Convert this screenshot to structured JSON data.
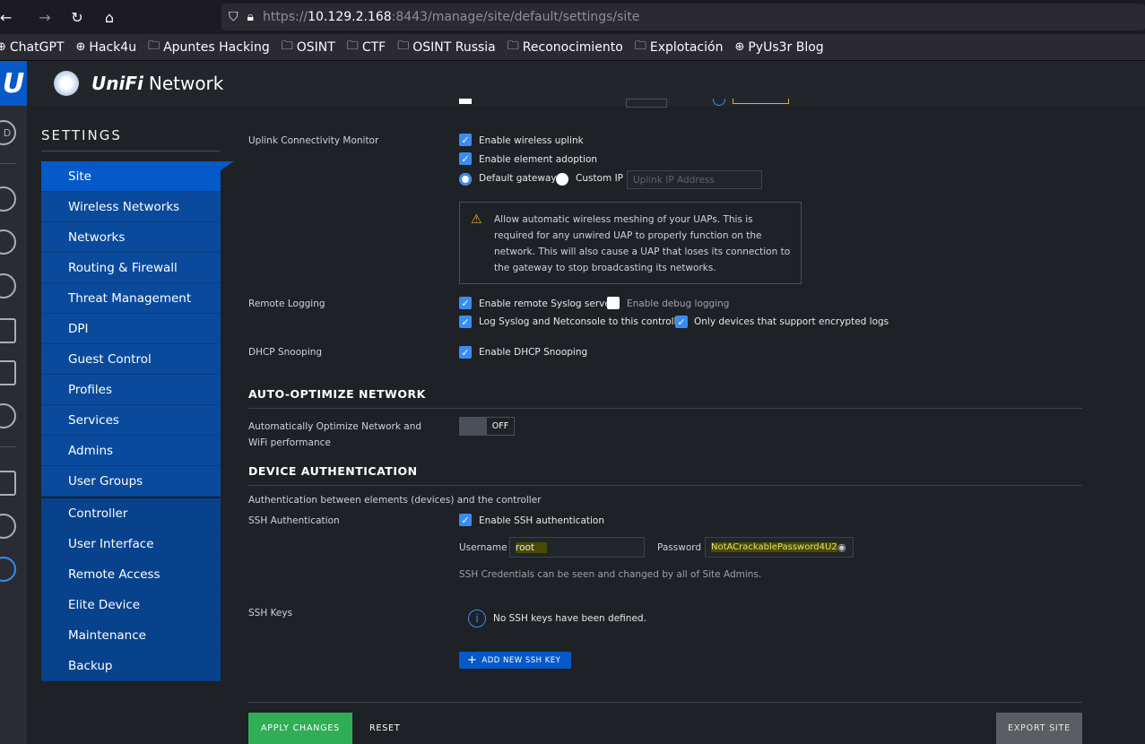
{
  "browser": {
    "url_prefix": "https://",
    "url_host": "10.129.2.168",
    "url_path": ":8443/manage/site/default/settings/site"
  },
  "bookmarks": [
    {
      "label": "ChatGPT",
      "icon": "globe-icon"
    },
    {
      "label": "Hack4u",
      "icon": "globe-icon"
    },
    {
      "label": "Apuntes Hacking",
      "icon": "folder-icon"
    },
    {
      "label": "OSINT",
      "icon": "folder-icon"
    },
    {
      "label": "CTF",
      "icon": "folder-icon"
    },
    {
      "label": "OSINT Russia",
      "icon": "folder-icon"
    },
    {
      "label": "Reconocimiento",
      "icon": "folder-icon"
    },
    {
      "label": "Explotación",
      "icon": "folder-icon"
    },
    {
      "label": "PyUs3r Blog",
      "icon": "globe-icon"
    }
  ],
  "header": {
    "brand_unifi": "UniFi",
    "brand_network": "Network"
  },
  "rail": {
    "top_badge": "D"
  },
  "settings": {
    "title": "SETTINGS",
    "menu_group1": [
      "Site",
      "Wireless Networks",
      "Networks",
      "Routing & Firewall",
      "Threat Management",
      "DPI",
      "Guest Control",
      "Profiles",
      "Services",
      "Admins",
      "User Groups"
    ],
    "menu_group2": [
      "Controller",
      "User Interface",
      "Remote Access",
      "Elite Device",
      "Maintenance",
      "Backup"
    ]
  },
  "uplink": {
    "label": "Uplink Connectivity Monitor",
    "enable_wireless": "Enable wireless uplink",
    "enable_adoption": "Enable element adoption",
    "default_gateway": "Default gateway",
    "custom_ip": "Custom IP",
    "ip_placeholder": "Uplink IP Address",
    "warning": "Allow automatic wireless meshing of your UAPs. This is required for any unwired UAP to properly function on the network. This will also cause a UAP that loses its connection to the gateway to stop broadcasting its networks."
  },
  "remote_logging": {
    "label": "Remote Logging",
    "enable_syslog": "Enable remote Syslog server",
    "enable_debug": "Enable debug logging",
    "log_netconsole": "Log Syslog and Netconsole to this controller",
    "only_encrypted": "Only devices that support encrypted logs"
  },
  "dhcp": {
    "label": "DHCP Snooping",
    "enable": "Enable DHCP Snooping"
  },
  "auto_optimize": {
    "heading": "AUTO-OPTIMIZE NETWORK",
    "label": "Automatically Optimize Network and WiFi performance",
    "toggle": "OFF"
  },
  "device_auth": {
    "heading": "DEVICE AUTHENTICATION",
    "subtitle": "Authentication between elements (devices) and the controller",
    "ssh_label": "SSH Authentication",
    "enable_ssh": "Enable SSH authentication",
    "username_label": "Username",
    "username_value": "root",
    "password_label": "Password",
    "password_value": "NotACrackablePassword4U2",
    "hint": "SSH Credentials can be seen and changed by all of Site Admins.",
    "ssh_keys_label": "SSH Keys",
    "no_keys": "No SSH keys have been defined.",
    "add_key": "ADD NEW SSH KEY"
  },
  "footer": {
    "apply": "APPLY CHANGES",
    "reset": "RESET",
    "export": "EXPORT SITE"
  },
  "colors": {
    "accent": "#0559c9",
    "checkbox": "#3b8cf0",
    "apply": "#2fae56",
    "warning": "#f0a63a"
  }
}
